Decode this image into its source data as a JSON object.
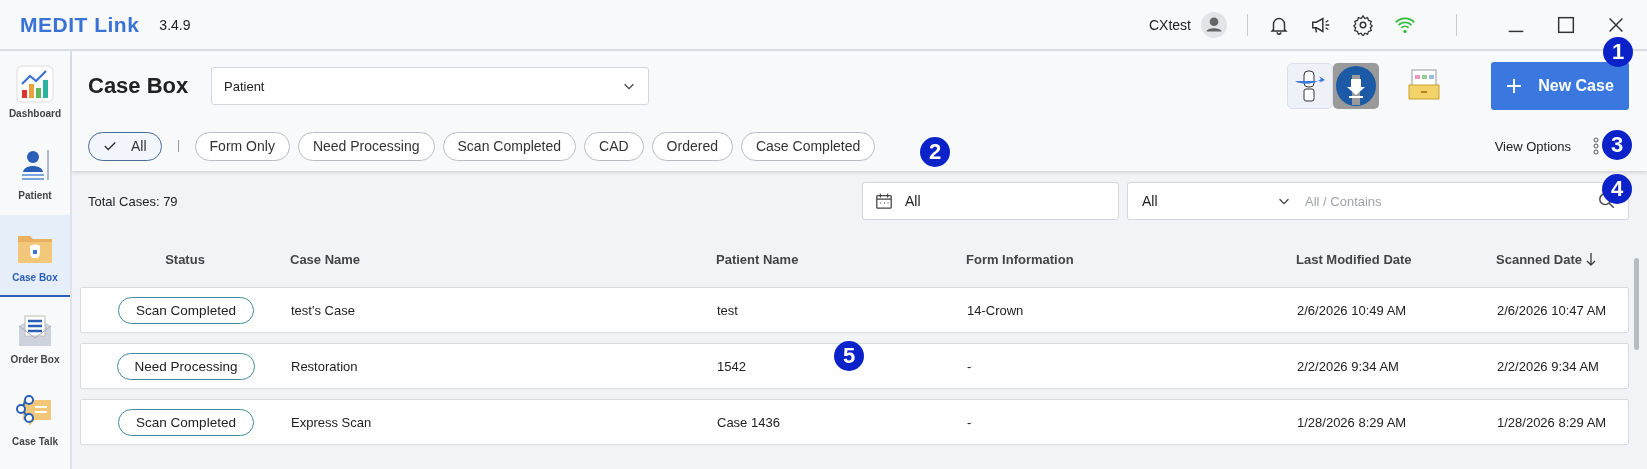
{
  "app": {
    "logo": "MEDIT Link",
    "version": "3.4.9",
    "user": "CXtest"
  },
  "sidebar": {
    "items": [
      {
        "label": "Dashboard",
        "kind": "dashboard",
        "selected": false
      },
      {
        "label": "Patient",
        "kind": "patient",
        "selected": false
      },
      {
        "label": "Case Box",
        "kind": "casebox",
        "selected": true
      },
      {
        "label": "Order Box",
        "kind": "orderbox",
        "selected": false
      },
      {
        "label": "Case Talk",
        "kind": "casetalk",
        "selected": false
      }
    ]
  },
  "header": {
    "title": "Case Box",
    "dropdown": "Patient",
    "new_case_button": "New Case"
  },
  "filters": [
    {
      "label": "All",
      "selected": true
    },
    {
      "label": "Form Only",
      "selected": false
    },
    {
      "label": "Need Processing",
      "selected": false
    },
    {
      "label": "Scan Completed",
      "selected": false
    },
    {
      "label": "CAD",
      "selected": false
    },
    {
      "label": "Ordered",
      "selected": false
    },
    {
      "label": "Case Completed",
      "selected": false
    }
  ],
  "view_options": "View Options",
  "toolbar": {
    "total": "Total Cases: 79",
    "date_filter": "All",
    "field_filter": "All",
    "search_placeholder": "All / Contains"
  },
  "table": {
    "columns": [
      "Status",
      "Case Name",
      "Patient Name",
      "Form Information",
      "Last Modified Date",
      "Scanned Date"
    ],
    "rows": [
      {
        "status": "Scan Completed",
        "case_name": "test's Case",
        "patient": "test",
        "form": "14-Crown",
        "modified": "2/6/2026 10:49 AM",
        "scanned": "2/6/2026 10:47 AM"
      },
      {
        "status": "Need Processing",
        "case_name": "Restoration",
        "patient": "1542",
        "form": "-",
        "modified": "2/2/2026 9:34 AM",
        "scanned": "2/2/2026 9:34 AM"
      },
      {
        "status": "Scan Completed",
        "case_name": "Express Scan",
        "patient": "Case 1436",
        "form": "-",
        "modified": "1/28/2026 8:29 AM",
        "scanned": "1/28/2026 8:29 AM"
      }
    ]
  },
  "callouts": [
    "1",
    "2",
    "3",
    "4",
    "5"
  ]
}
